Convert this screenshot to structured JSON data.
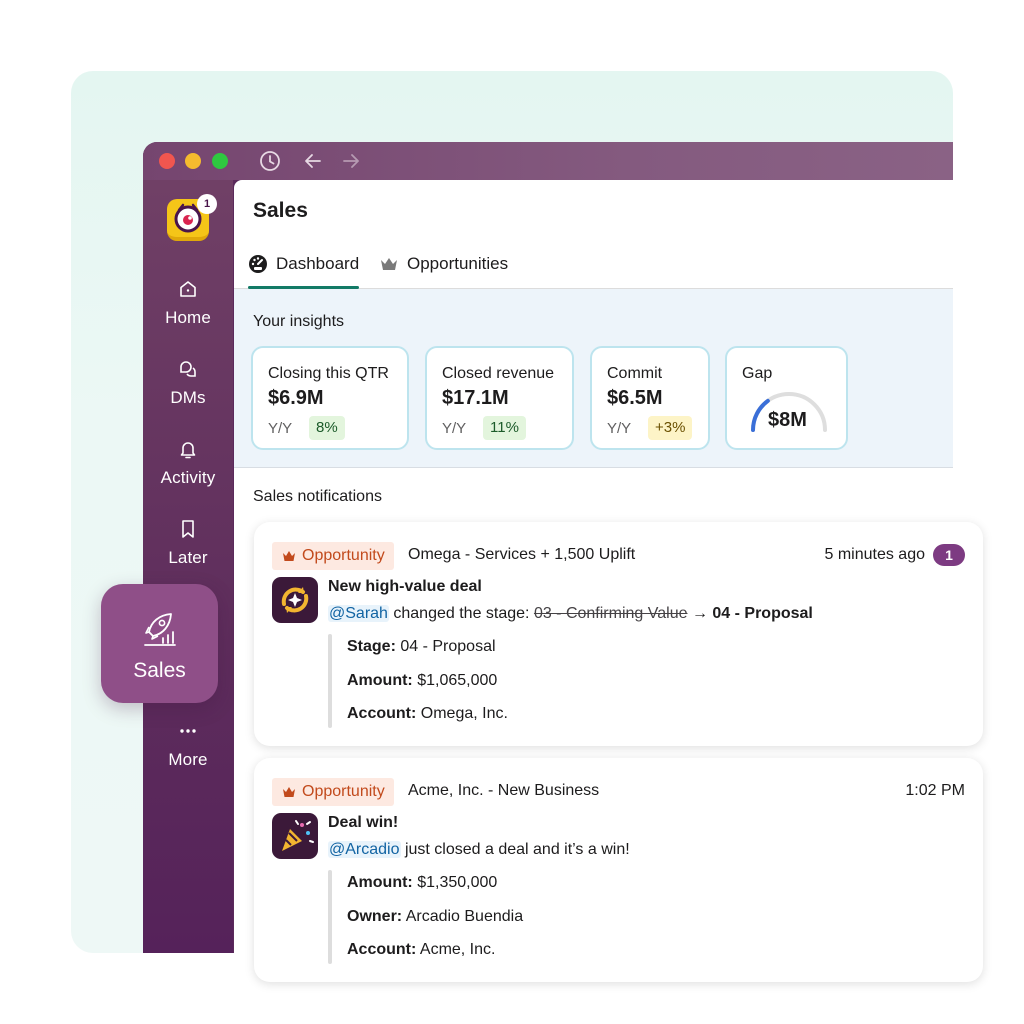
{
  "sidebar": {
    "workspace_badge": "1",
    "items": [
      {
        "label": "Home",
        "icon": "home-icon"
      },
      {
        "label": "DMs",
        "icon": "dms-icon"
      },
      {
        "label": "Activity",
        "icon": "bell-icon"
      },
      {
        "label": "Later",
        "icon": "bookmark-icon"
      },
      {
        "label": "More",
        "icon": "more-icon"
      }
    ],
    "active_item": {
      "label": "Sales",
      "icon": "rocket-chart-icon"
    }
  },
  "main": {
    "title": "Sales",
    "tabs": [
      {
        "label": "Dashboard",
        "icon": "speedometer-icon",
        "active": true
      },
      {
        "label": "Opportunities",
        "icon": "crown-icon",
        "active": false
      }
    ],
    "insights": {
      "title": "Your insights",
      "cards": [
        {
          "label": "Closing this QTR",
          "value": "$6.9M",
          "yy_label": "Y/Y",
          "change": "8%",
          "tone": "green"
        },
        {
          "label": "Closed revenue",
          "value": "$17.1M",
          "yy_label": "Y/Y",
          "change": "11%",
          "tone": "green"
        },
        {
          "label": "Commit",
          "value": "$6.5M",
          "yy_label": "Y/Y",
          "change": "+3%",
          "tone": "yellow"
        },
        {
          "label": "Gap",
          "value": "$8M",
          "gauge_fraction": 0.3
        }
      ]
    },
    "notifications_title": "Sales notifications"
  },
  "notifications": [
    {
      "tag": "Opportunity",
      "headline": "Omega - Services + 1,500 Uplift",
      "time": "5 minutes ago",
      "unread_count": "1",
      "title": "New high-value deal",
      "mention": "@Sarah",
      "text_before": " changed the stage: ",
      "old_stage": "03 - Confirming Value",
      "arrow": " → ",
      "new_stage": "04 - Proposal",
      "fields": [
        {
          "key": "Stage:",
          "value": " 04 - Proposal"
        },
        {
          "key": "Amount:",
          "value": " $1,065,000"
        },
        {
          "key": "Account:",
          "value": " Omega, Inc."
        }
      ]
    },
    {
      "tag": "Opportunity",
      "headline": "Acme, Inc. - New Business",
      "time": "1:02 PM",
      "title": "Deal win!",
      "mention": "@Arcadio",
      "text_after": " just closed a deal and it’s a win!",
      "fields": [
        {
          "key": "Amount:",
          "value": " $1,350,000"
        },
        {
          "key": "Owner:",
          "value": " Arcadio Buendia"
        },
        {
          "key": "Account:",
          "value": " Acme, Inc."
        }
      ]
    }
  ],
  "colors": {
    "aubergine": "#5e2d5c",
    "accent_green": "#127a66",
    "tag_bg": "#fde9e1",
    "tag_text": "#c24a1c",
    "mention": "#1264a3",
    "gauge_arc": "#3a6fd8"
  }
}
